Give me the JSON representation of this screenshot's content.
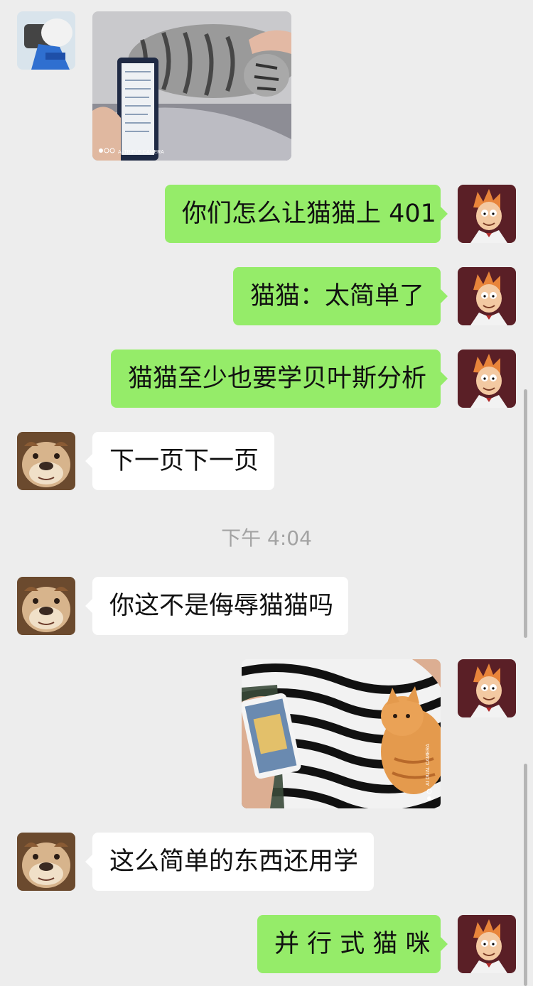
{
  "chat": {
    "timestamp": "下午 4:04",
    "messages": [
      {
        "sender": "friend",
        "kind": "image",
        "subject": "cat with phone"
      },
      {
        "sender": "me",
        "kind": "text",
        "text": "你们怎么让猫猫上 401"
      },
      {
        "sender": "me",
        "kind": "text",
        "text": "猫猫：太简单了"
      },
      {
        "sender": "me",
        "kind": "text",
        "text": "猫猫至少也要学贝叶斯分析"
      },
      {
        "sender": "dog",
        "kind": "text",
        "text": "下一页下一页"
      },
      {
        "sender": "dog",
        "kind": "text",
        "text": "你这不是侮辱猫猫吗"
      },
      {
        "sender": "me",
        "kind": "image",
        "subject": "orange kitten with phone game"
      },
      {
        "sender": "dog",
        "kind": "text",
        "text": "这么简单的东西还用学"
      },
      {
        "sender": "me",
        "kind": "text",
        "text": "并 行 式 猫 咪"
      }
    ]
  },
  "images": {
    "photo_1_watermark": "AI TRIPLE CAMERA",
    "photo_2_watermark": "AI DUAL CAMERA"
  },
  "colors": {
    "background": "#ededed",
    "outgoing_bubble": "#95ec69",
    "incoming_bubble": "#ffffff"
  },
  "icons": {
    "friend_avatar": "blue-figure-avatar",
    "self_avatar": "cartoon-character-avatar",
    "dog_avatar": "bulldog-avatar"
  }
}
